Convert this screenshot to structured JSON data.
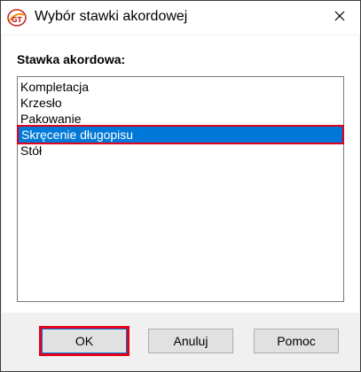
{
  "window": {
    "title": "Wybór stawki akordowej",
    "icon": "app-logo-icon",
    "close_icon": "close-icon"
  },
  "main": {
    "label": "Stawka akordowa:",
    "items": [
      {
        "label": "Kompletacja",
        "selected": false
      },
      {
        "label": "Krzesło",
        "selected": false
      },
      {
        "label": "Pakowanie",
        "selected": false
      },
      {
        "label": "Skręcenie długopisu",
        "selected": true
      },
      {
        "label": "Stół",
        "selected": false
      }
    ],
    "selection_color": "#0078d7",
    "highlight_color": "#e4001b"
  },
  "buttons": {
    "ok_label": "OK",
    "cancel_label": "Anuluj",
    "help_label": "Pomoc"
  }
}
